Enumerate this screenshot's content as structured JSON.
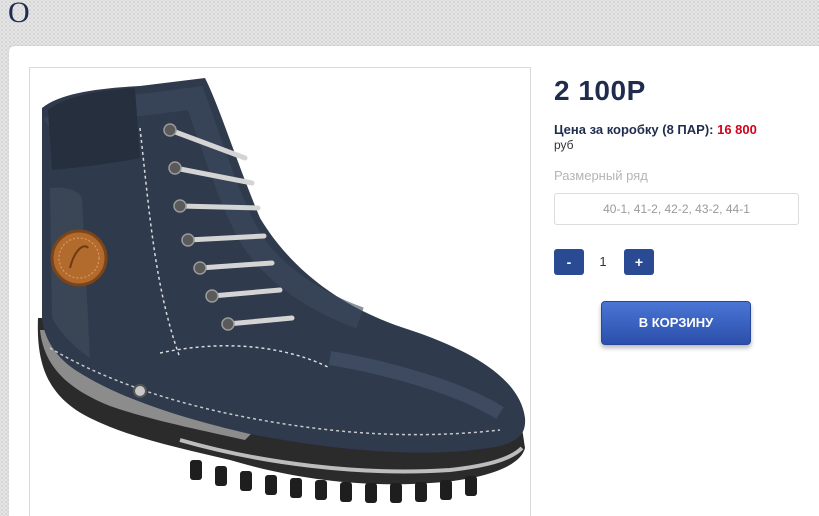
{
  "header": {
    "logo_letter": "O"
  },
  "product": {
    "image_alt": "Ботинок",
    "price": "2 100Р",
    "box_price_label": "Цена за коробку (8 ПАР):",
    "box_price_value": "16 800",
    "box_price_unit": "руб",
    "size_label": "Размерный ряд",
    "size_value": "40-1, 41-2, 42-2, 43-2, 44-1",
    "quantity": {
      "minus_label": "-",
      "value": "1",
      "plus_label": "+"
    },
    "cart_button_label": "В КОРЗИНУ"
  },
  "colors": {
    "accent": "#2a4a93",
    "price_text": "#1f2c4d",
    "box_price_value": "#d0021b"
  }
}
